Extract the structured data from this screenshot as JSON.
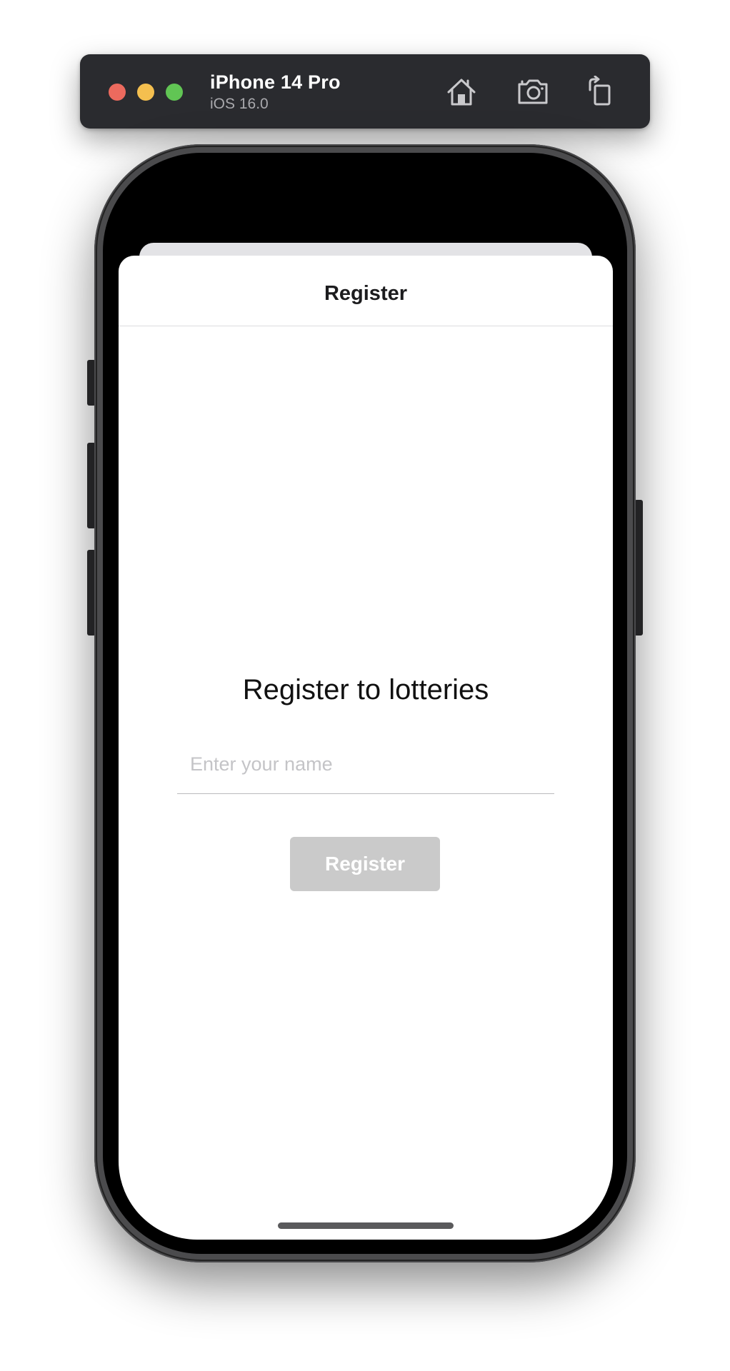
{
  "simulator": {
    "device_name": "iPhone 14 Pro",
    "os_version": "iOS 16.0",
    "buttons": {
      "home_icon": "home-icon",
      "screenshot_icon": "camera-icon",
      "rotate_icon": "rotate-icon"
    }
  },
  "sheet": {
    "nav_title": "Register",
    "heading": "Register to lotteries",
    "name_field": {
      "placeholder": "Enter your name",
      "value": ""
    },
    "register_button": {
      "label": "Register",
      "enabled": false
    }
  },
  "colors": {
    "toolbar_bg": "#2a2b2f",
    "traffic_red": "#ec6a5e",
    "traffic_yellow": "#f4bf4f",
    "traffic_green": "#61c554",
    "disabled_button": "#cacaca"
  }
}
